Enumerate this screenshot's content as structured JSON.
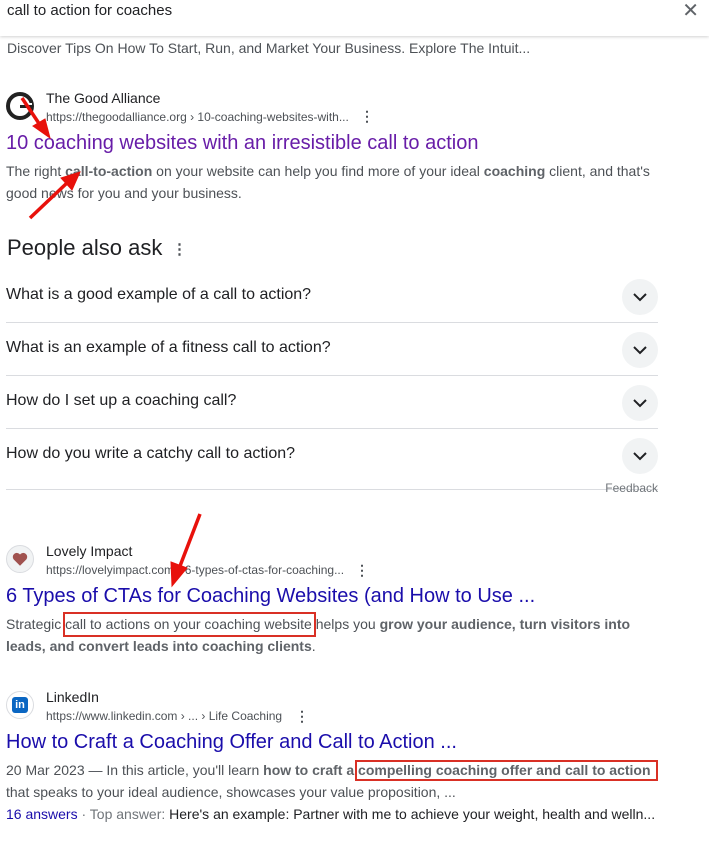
{
  "search": {
    "query": "call to action for coaches",
    "close_icon": "close-icon"
  },
  "top_snippet": "Discover Tips On How To Start, Run, and Market Your Business. Explore The Intuit...",
  "results": [
    {
      "site": "The Good Alliance",
      "url": "https://thegoodalliance.org › 10-coaching-websites-with...",
      "title": "10 coaching websites with an irresistible call to action",
      "snippet_parts": [
        "The right ",
        "call-to-action",
        " on your website can help you find more of your ideal ",
        "coaching",
        " client, and that's good news for you and your business."
      ]
    },
    {
      "site": "Lovely Impact",
      "url": "https://lovelyimpact.com › 6-types-of-ctas-for-coaching...",
      "title": "6 Types of CTAs for Coaching Websites (and How to Use ...",
      "snippet_parts": [
        "Strategic ",
        "call to actions on your coaching website",
        " helps you ",
        "grow your audience, turn visitors into leads, and convert leads into coaching clients",
        "."
      ]
    },
    {
      "site": "LinkedIn",
      "url": "https://www.linkedin.com › ... › Life Coaching",
      "title": "How to Craft a Coaching Offer and Call to Action ...",
      "snippet_parts": [
        "20 Mar 2023 — In this article, you'll learn ",
        "how to craft a ",
        "compelling coaching offer and call to action",
        " that speaks to your ideal audience, showcases your value proposition, ..."
      ],
      "answers": "16 answers",
      "top_answer_label": " · Top answer: ",
      "top_answer": "Here's an example: Partner with me to achieve your weight, health and welln..."
    }
  ],
  "paa": {
    "heading": "People also ask",
    "questions": [
      "What is a good example of a call to action?",
      "What is an example of a fitness call to action?",
      "How do I set up a coaching call?",
      "How do you write a catchy call to action?"
    ],
    "feedback": "Feedback"
  },
  "colors": {
    "visited_link": "#681da8",
    "link": "#1a0dab",
    "annotation": "#d93025"
  }
}
